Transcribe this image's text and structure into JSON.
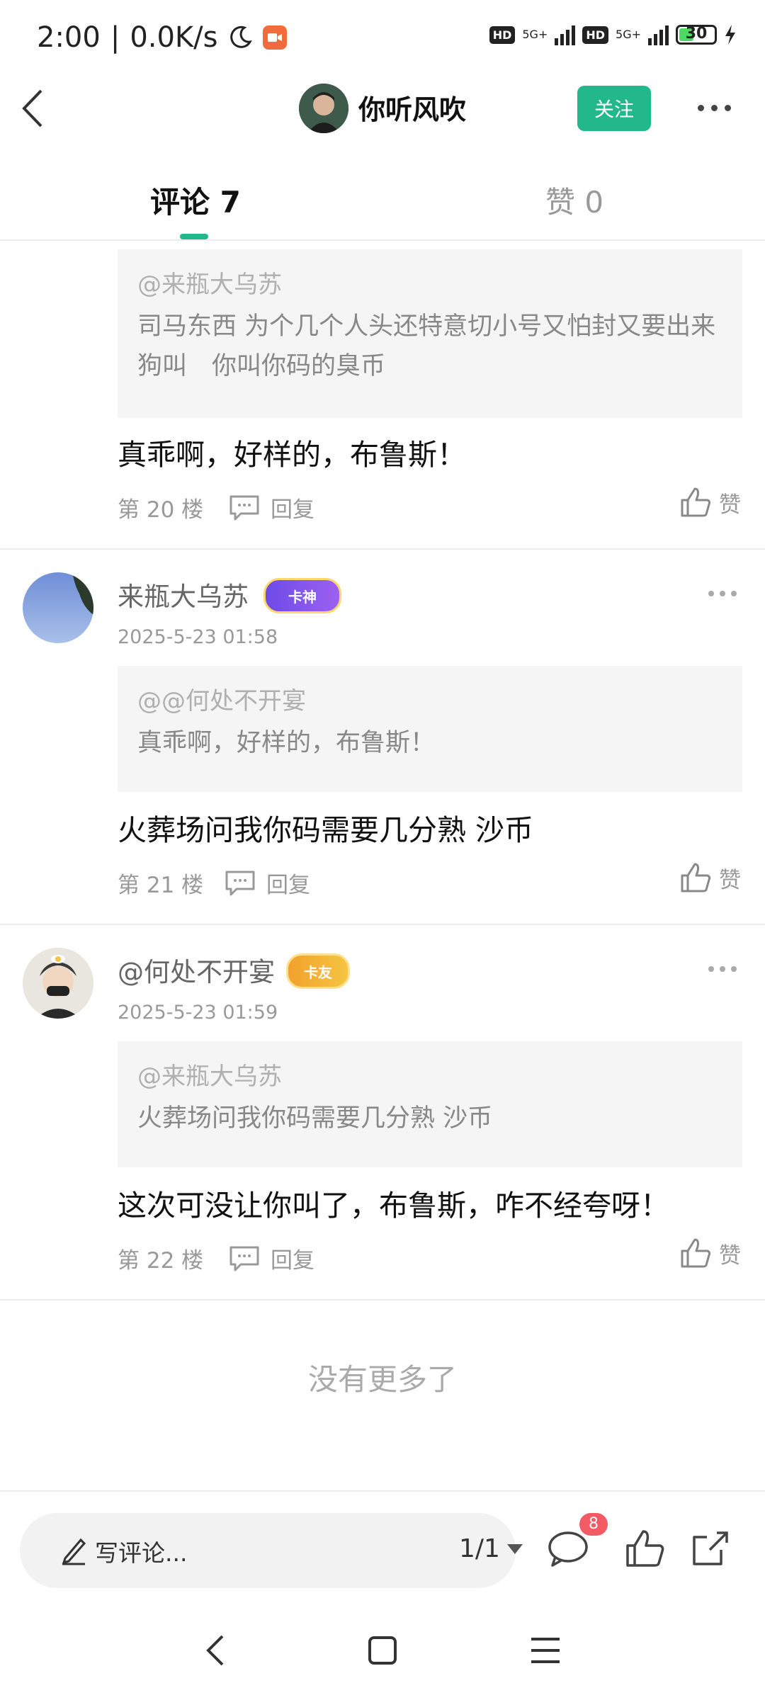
{
  "status_bar": {
    "time": "2:00",
    "speed": "0.0K/s",
    "net1": "5G+",
    "net2": "5G+",
    "battery": "30",
    "hd1": "HD",
    "hd2": "HD",
    "separator": "|"
  },
  "header": {
    "author_name": "你听风吹",
    "follow_label": "关注"
  },
  "tabs": {
    "comments": "评论 7",
    "likes": "赞 0"
  },
  "comments": [
    {
      "quote_author": "@来瓶大乌苏",
      "quote_text": "司马东西 为个几个人头还特意切小号又怕封又要出来狗叫　你叫你码的臭币",
      "body": "真乖啊，好样的，布鲁斯！",
      "floor": "第 20 楼",
      "reply": "回复",
      "like": "赞"
    },
    {
      "name": "来瓶大乌苏",
      "badge": "卡神",
      "time": "2025-5-23 01:58",
      "quote_author": "@@何处不开宴",
      "quote_text": "真乖啊，好样的，布鲁斯！",
      "body": "火葬场问我你码需要几分熟  沙币",
      "floor": "第 21 楼",
      "reply": "回复",
      "like": "赞"
    },
    {
      "name": "@何处不开宴",
      "badge": "卡友",
      "time": "2025-5-23 01:59",
      "quote_author": "@来瓶大乌苏",
      "quote_text": "火葬场问我你码需要几分熟  沙币",
      "body": "这次可没让你叫了，布鲁斯，咋不经夸呀！",
      "floor": "第 22 楼",
      "reply": "回复",
      "like": "赞"
    }
  ],
  "no_more": "没有更多了",
  "bottom_bar": {
    "placeholder": "写评论...",
    "page": "1/1",
    "comment_count": "8"
  },
  "colors": {
    "accent": "#23b88c",
    "notif": "#f25b63"
  }
}
